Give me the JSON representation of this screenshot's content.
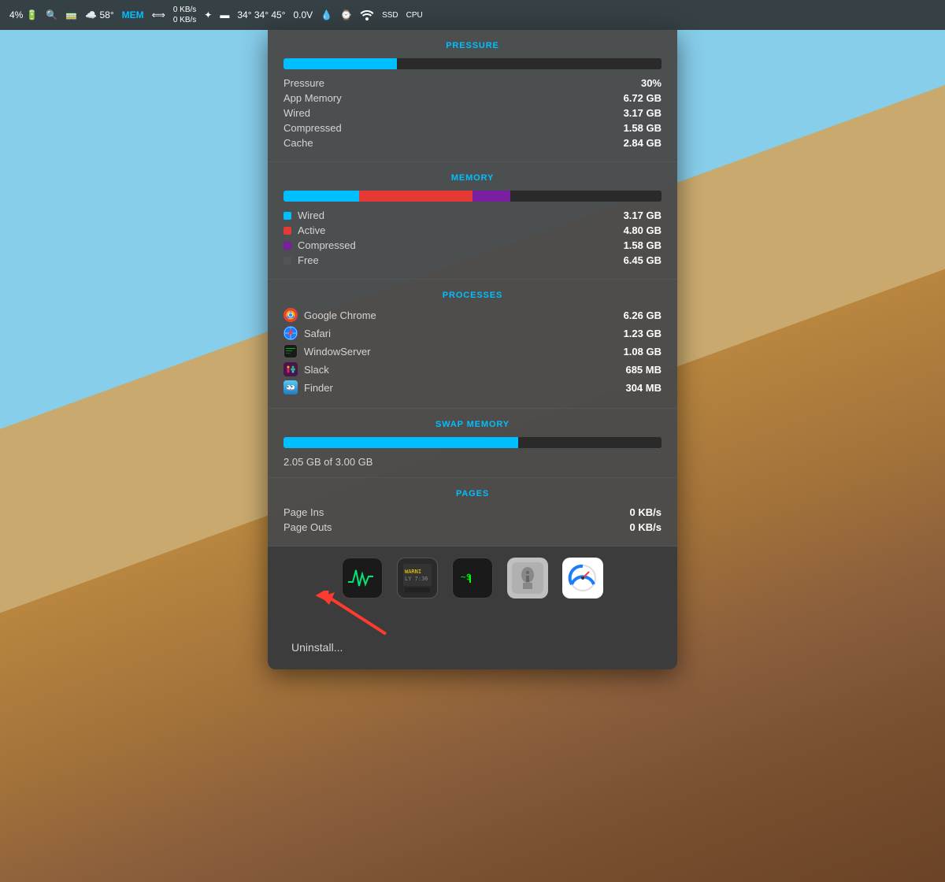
{
  "menubar": {
    "items": [
      {
        "label": "4%",
        "name": "battery-percent"
      },
      {
        "label": "🚃",
        "name": "transit-icon"
      },
      {
        "label": "☁️ 58°",
        "name": "weather"
      },
      {
        "label": "MEM",
        "name": "mem-indicator"
      },
      {
        "label": "⟺",
        "name": "resize-icon"
      },
      {
        "label": "0 KB/s\n0 KB/s",
        "name": "network-speed"
      },
      {
        "label": "✦",
        "name": "misc-icon"
      },
      {
        "label": "▬",
        "name": "display-icon"
      },
      {
        "label": "34° 34° 45°",
        "name": "temp-readings"
      },
      {
        "label": "0.0V",
        "name": "voltage"
      },
      {
        "label": "💧",
        "name": "drop-icon"
      },
      {
        "label": "⌚",
        "name": "watch-icon"
      },
      {
        "label": "WiFi",
        "name": "wifi-icon"
      },
      {
        "label": "SSD",
        "name": "ssd-icon"
      },
      {
        "label": "CPU",
        "name": "cpu-icon"
      }
    ]
  },
  "popup": {
    "pressure": {
      "title": "PRESSURE",
      "bar_fill_percent": 30,
      "rows": [
        {
          "label": "Pressure",
          "value": "30%"
        },
        {
          "label": "App Memory",
          "value": "6.72 GB"
        },
        {
          "label": "Wired",
          "value": "3.17 GB"
        },
        {
          "label": "Compressed",
          "value": "1.58 GB"
        },
        {
          "label": "Cache",
          "value": "2.84 GB"
        }
      ]
    },
    "memory": {
      "title": "MEMORY",
      "bars": [
        {
          "color": "#00BFFF",
          "width_pct": 20
        },
        {
          "color": "#E53935",
          "width_pct": 30
        },
        {
          "color": "#7B1FA2",
          "width_pct": 10
        },
        {
          "color": "#2a2a2a",
          "width_pct": 40
        }
      ],
      "rows": [
        {
          "label": "Wired",
          "value": "3.17 GB",
          "color": "#00BFFF"
        },
        {
          "label": "Active",
          "value": "4.80 GB",
          "color": "#E53935"
        },
        {
          "label": "Compressed",
          "value": "1.58 GB",
          "color": "#7B1FA2"
        },
        {
          "label": "Free",
          "value": "6.45 GB",
          "color": "#555555"
        }
      ]
    },
    "processes": {
      "title": "PROCESSES",
      "rows": [
        {
          "label": "Google Chrome",
          "value": "6.26 GB",
          "icon_color": "#EA4335",
          "icon_char": "🌐"
        },
        {
          "label": "Safari",
          "value": "1.23 GB",
          "icon_char": "🧭"
        },
        {
          "label": "WindowServer",
          "value": "1.08 GB",
          "icon_char": "⬛"
        },
        {
          "label": "Slack",
          "value": "685 MB",
          "icon_char": "#"
        },
        {
          "label": "Finder",
          "value": "304 MB",
          "icon_char": "◎"
        }
      ]
    },
    "swap_memory": {
      "title": "SWAP MEMORY",
      "fill_text": "2.05 GB of 3.00 GB",
      "fill_pct": 68
    },
    "pages": {
      "title": "PAGES",
      "rows": [
        {
          "label": "Page Ins",
          "value": "0 KB/s"
        },
        {
          "label": "Page Outs",
          "value": "0 KB/s"
        }
      ]
    },
    "dock": {
      "uninstall_label": "Uninstall..."
    }
  }
}
